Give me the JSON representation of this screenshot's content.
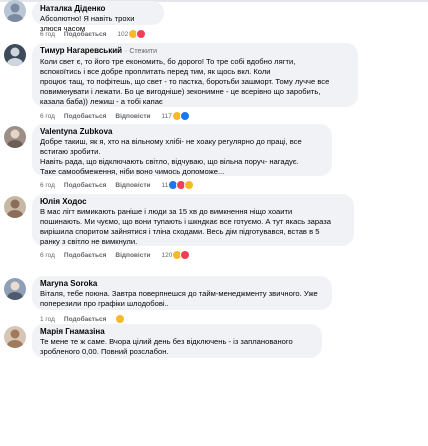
{
  "actions": {
    "like": "Подобається",
    "reply": "Відповісти"
  },
  "comments": [
    {
      "author": "Наталка Діденко",
      "role": "",
      "lines": [
        "Абсолютно! Я навіть трохи злюся часом"
      ],
      "time": "6 год",
      "reply": false,
      "count": "102",
      "reactions": [
        "care",
        "heart"
      ]
    },
    {
      "author": "Тимур Нагаревський",
      "role": "· Стежити",
      "lines": [
        "Коли свет є, то його тре економить, бо дорого! То тре собі вдобно лягти,",
        "вспокоїтись і все добре проплитать перед тим, як щось вкл. Коли",
        "процює тащ, то пофітешь, що свет - то пастка, боротьби зашморт. Тому лучче все",
        "повимкнувати і лежати. Бо це вигодніше) зеконимне - це всерівно що заробить,",
        "казала баба)) лежиш - а тобі капає"
      ],
      "time": "6 год",
      "reply": true,
      "count": "117",
      "reactions": [
        "care",
        "like"
      ]
    },
    {
      "author": "Valentyna Zubkova",
      "role": "",
      "lines": [
        "Добре такиш, як я, хто на вільному хлібі- не хоаку регулярно до праці, все",
        "встигаю зробити.",
        "Навіть рада, що відключають світло, відчуваю, що вільна поруч- нагадує.",
        "Таке самообмеження, ніби воно чимось допоможе..."
      ],
      "time": "6 год",
      "reply": true,
      "count": "11",
      "reactions": [
        "like",
        "heart",
        "wow"
      ]
    },
    {
      "author": "Юлія Ходос",
      "role": "",
      "lines": [
        "В мас лігт вимикають раніше і люди за 15 хв до вимкнення ніщо хоаити",
        "пошинають. Ми чуємо, що вони тупають і шкндкає все готуємо. А тут якась зараза",
        "вирішила споритом зайнятися і тлінa сходами. Весь дім підготувався, встав в 5",
        "ранку з світло не вимкнули."
      ],
      "time": "6 год",
      "reply": true,
      "count": "120",
      "reactions": [
        "care",
        "heart"
      ]
    },
    {
      "author": "Maryna Soroka",
      "role": "",
      "lines": [
        "Віталя, тебе поюна. Завтра поверпнешся до тайм-менеджменту звичного. Уже",
        "поперезили про графіки шлодобові.."
      ],
      "time": "1 год",
      "reply": false,
      "count": "",
      "reactions": [
        "care"
      ]
    },
    {
      "author": "Марія Гнамазіна",
      "role": "",
      "lines": [
        "Те мене те ж саме. Вчора цілий день без відключень - із запланованого",
        "зробленого 0,00. Повний розслабон."
      ],
      "time": "",
      "reply": false,
      "count": "",
      "reactions": []
    }
  ]
}
